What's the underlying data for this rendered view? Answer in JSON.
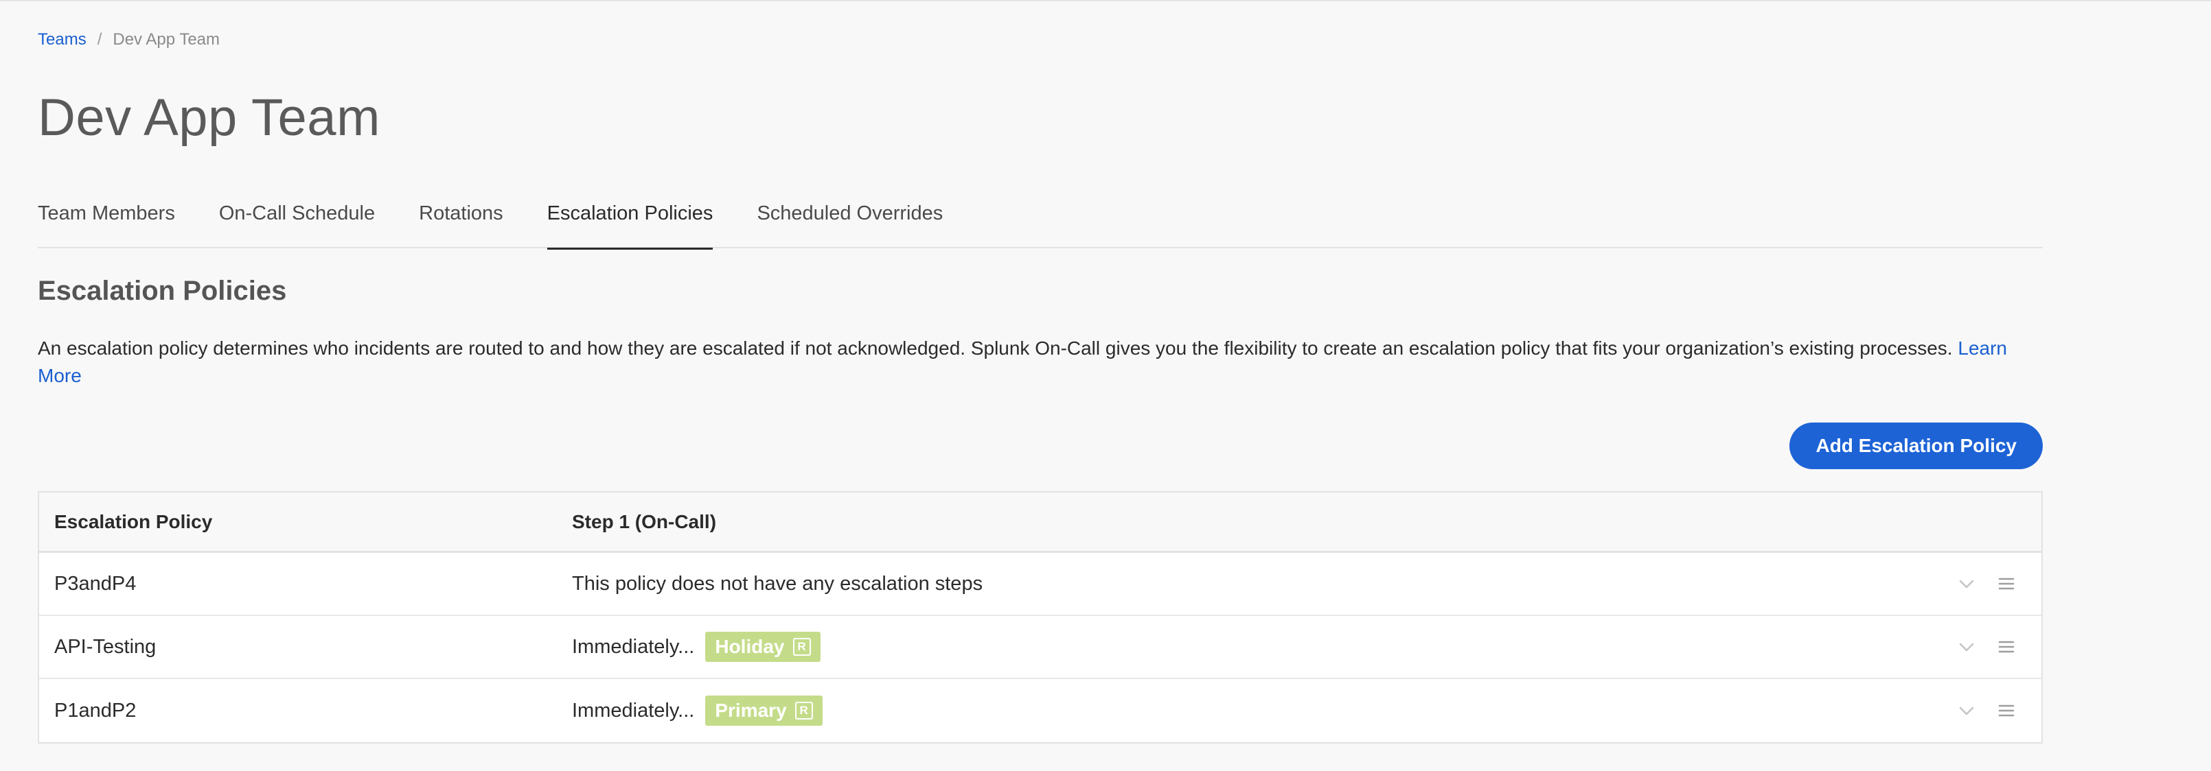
{
  "breadcrumb": {
    "parent": "Teams",
    "separator": "/",
    "current": "Dev App Team"
  },
  "page": {
    "title": "Dev App Team"
  },
  "tabs": [
    {
      "label": "Team Members",
      "active": false
    },
    {
      "label": "On-Call Schedule",
      "active": false
    },
    {
      "label": "Rotations",
      "active": false
    },
    {
      "label": "Escalation Policies",
      "active": true
    },
    {
      "label": "Scheduled Overrides",
      "active": false
    }
  ],
  "section": {
    "title": "Escalation Policies",
    "description": "An escalation policy determines who incidents are routed to and how they are escalated if not acknowledged. Splunk On-Call gives you the flexibility to create an escalation policy that fits your organization’s existing processes. ",
    "learn_more": "Learn More",
    "add_button": "Add Escalation Policy"
  },
  "table": {
    "headers": [
      "Escalation Policy",
      "Step 1 (On-Call)"
    ],
    "rows": [
      {
        "name": "P3andP4",
        "step": "This policy does not have any escalation steps",
        "badge": null,
        "badge_mark": null
      },
      {
        "name": "API-Testing",
        "step": "Immediately...",
        "badge": "Holiday",
        "badge_mark": "R"
      },
      {
        "name": "P1andP2",
        "step": "Immediately...",
        "badge": "Primary",
        "badge_mark": "R"
      }
    ]
  },
  "icons": {
    "row_expand": "chevron-down-icon",
    "row_menu": "menu-icon"
  },
  "colors": {
    "accent": "#1d63d6",
    "link": "#1a5fd0",
    "badge": "#c4dc8a"
  }
}
